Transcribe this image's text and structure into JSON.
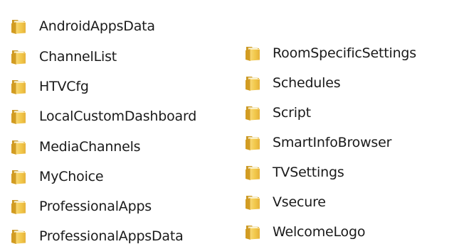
{
  "explorer": {
    "left_column": {
      "items": [
        {
          "label": "AndroidAppsData",
          "icon": "folder-icon"
        },
        {
          "label": "ChannelList",
          "icon": "folder-icon"
        },
        {
          "label": "HTVCfg",
          "icon": "folder-icon"
        },
        {
          "label": "LocalCustomDashboard",
          "icon": "folder-icon"
        },
        {
          "label": "MediaChannels",
          "icon": "folder-icon"
        },
        {
          "label": "MyChoice",
          "icon": "folder-icon"
        },
        {
          "label": "ProfessionalApps",
          "icon": "folder-icon"
        },
        {
          "label": "ProfessionalAppsData",
          "icon": "folder-icon"
        }
      ]
    },
    "right_column": {
      "items": [
        {
          "label": "RoomSpecificSettings",
          "icon": "folder-icon"
        },
        {
          "label": "Schedules",
          "icon": "folder-icon"
        },
        {
          "label": "Script",
          "icon": "folder-icon"
        },
        {
          "label": "SmartInfoBrowser",
          "icon": "folder-icon"
        },
        {
          "label": "TVSettings",
          "icon": "folder-icon"
        },
        {
          "label": "Vsecure",
          "icon": "folder-icon"
        },
        {
          "label": "WelcomeLogo",
          "icon": "folder-icon"
        }
      ]
    },
    "colors": {
      "folder_front": "#f2c94c",
      "folder_back": "#d9a628",
      "folder_paper": "#fbf3d6",
      "text": "#1a1a1a",
      "background": "#ffffff"
    }
  }
}
